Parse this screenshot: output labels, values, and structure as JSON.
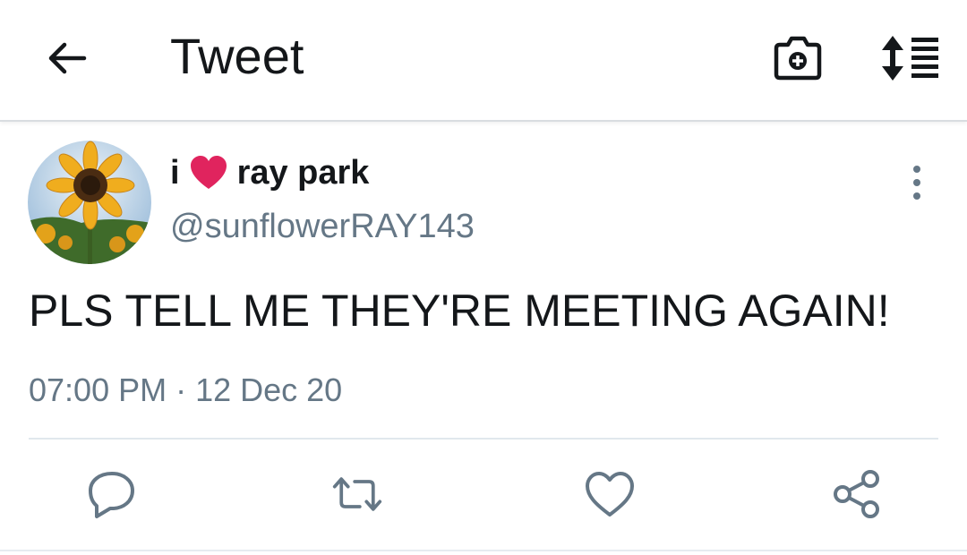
{
  "appbar": {
    "title": "Tweet",
    "icons": [
      "back-arrow-icon",
      "camera-plus-icon",
      "sort-list-icon"
    ]
  },
  "tweet": {
    "display_name_prefix": "i",
    "display_name_suffix": "ray park",
    "handle": "@sunflowerRAY143",
    "text": "PLS TELL ME THEY'RE MEETING AGAIN!",
    "timestamp": "07:00 PM · 12 Dec 20"
  },
  "actions": [
    "reply-icon",
    "retweet-icon",
    "like-icon",
    "share-icon"
  ],
  "colors": {
    "text": "#14171a",
    "secondary": "#657786",
    "divider": "#e1e8ed",
    "heart": "#e0245e"
  }
}
